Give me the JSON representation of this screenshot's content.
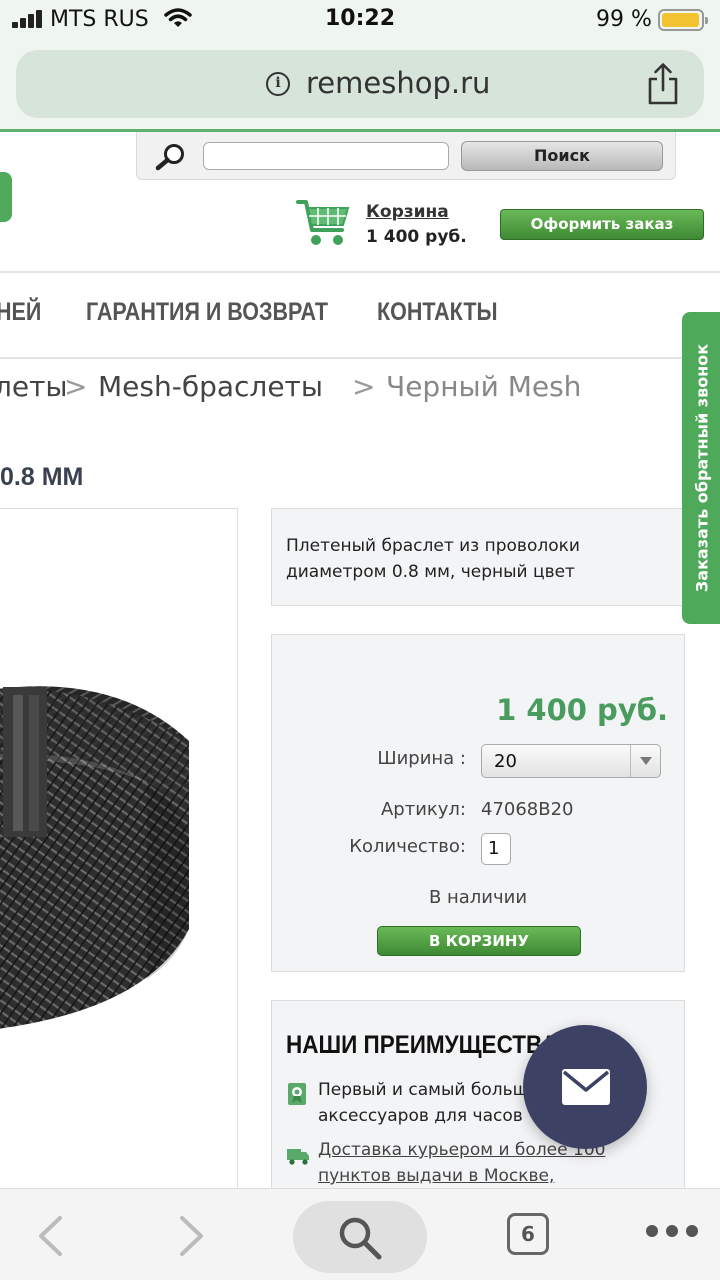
{
  "status_bar": {
    "carrier": "MTS RUS",
    "time": "10:22",
    "battery": "99 %",
    "battery_level": 0.99
  },
  "browser": {
    "url": "remeshop.ru",
    "tab_count": "6"
  },
  "header": {
    "search_button": "Поиск",
    "search_value": "",
    "cart_label": "Корзина",
    "cart_total": "1 400 руб.",
    "checkout_button": "Оформить заказ"
  },
  "nav": {
    "items": [
      "НЕЙ",
      "ГАРАНТИЯ И ВОЗВРАТ",
      "КОНТАКТЫ"
    ]
  },
  "breadcrumb": {
    "items": [
      "леты",
      "Mesh-браслеты",
      "Черный Mesh"
    ],
    "separator": ">"
  },
  "product": {
    "title": "0.8 ММ",
    "description": "Плетеный браслет из проволоки диаметром 0.8 мм, черный цвет",
    "price": "1 400 руб.",
    "width_label": "Ширина :",
    "width_value": "20",
    "sku_label": "Артикул:",
    "sku_value": "47068B20",
    "qty_label": "Количество:",
    "qty_value": "1",
    "stock": "В наличии",
    "add_to_cart": "В КОРЗИНУ"
  },
  "advantages": {
    "title": "НАШИ ПРЕИМУЩЕСТВА",
    "items": [
      {
        "text": "Первый и самый большой магазин аксессуаров для часов",
        "icon": "certificate-icon"
      },
      {
        "text": "Доставка курьером и более 100 пунктов выдачи в Москве,",
        "icon": "truck-icon"
      }
    ]
  },
  "callback_tab": "Заказать обратный звонок",
  "colors": {
    "accent_green": "#4fa95a",
    "price_green": "#4a9b5e",
    "fab": "#3d4163"
  }
}
